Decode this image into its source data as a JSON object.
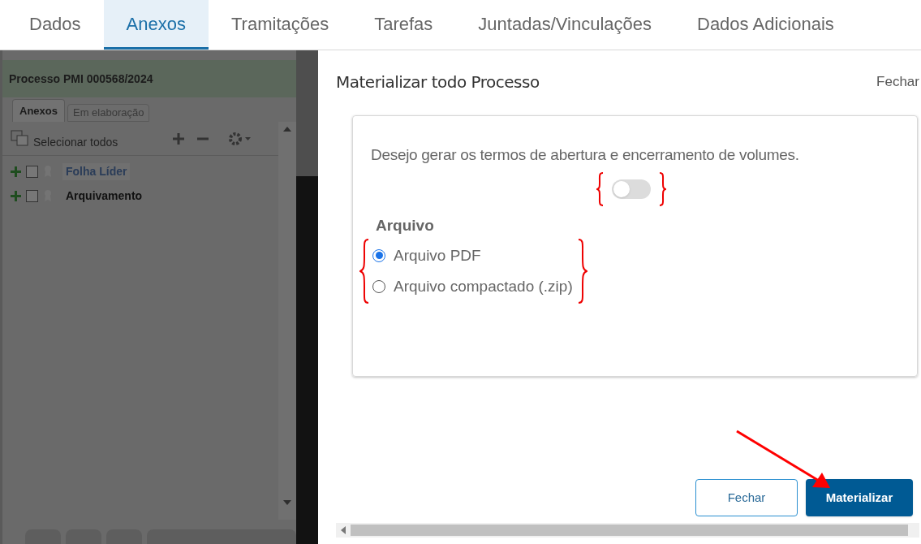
{
  "tabs": [
    {
      "label": "Dados",
      "selected": false
    },
    {
      "label": "Anexos",
      "selected": true
    },
    {
      "label": "Tramitações",
      "selected": false
    },
    {
      "label": "Tarefas",
      "selected": false
    },
    {
      "label": "Juntadas/Vinculações",
      "selected": false
    },
    {
      "label": "Dados Adicionais",
      "selected": false
    }
  ],
  "left_panel": {
    "title": "Processo PMI 000568/2024",
    "tabs": [
      {
        "label": "Anexos",
        "selected": true
      },
      {
        "label": "Em elaboração",
        "selected": false
      }
    ],
    "select_all": "Selecionar todos",
    "items": [
      {
        "label": "Folha Líder",
        "selected": true,
        "checked": false
      },
      {
        "label": "Arquivamento",
        "selected": false,
        "checked": false
      }
    ]
  },
  "modal": {
    "title": "Materializar todo Processo",
    "close_link": "Fechar",
    "question": "Desejo gerar os termos de abertura e encerramento de volumes.",
    "toggle_on": false,
    "file_group": "Arquivo",
    "options": [
      {
        "label": "Arquivo PDF",
        "selected": true
      },
      {
        "label": "Arquivo compactado (.zip)",
        "selected": false
      }
    ],
    "buttons": [
      {
        "label": "Fechar",
        "kind": "secondary"
      },
      {
        "label": "Materializar",
        "kind": "primary"
      }
    ]
  }
}
